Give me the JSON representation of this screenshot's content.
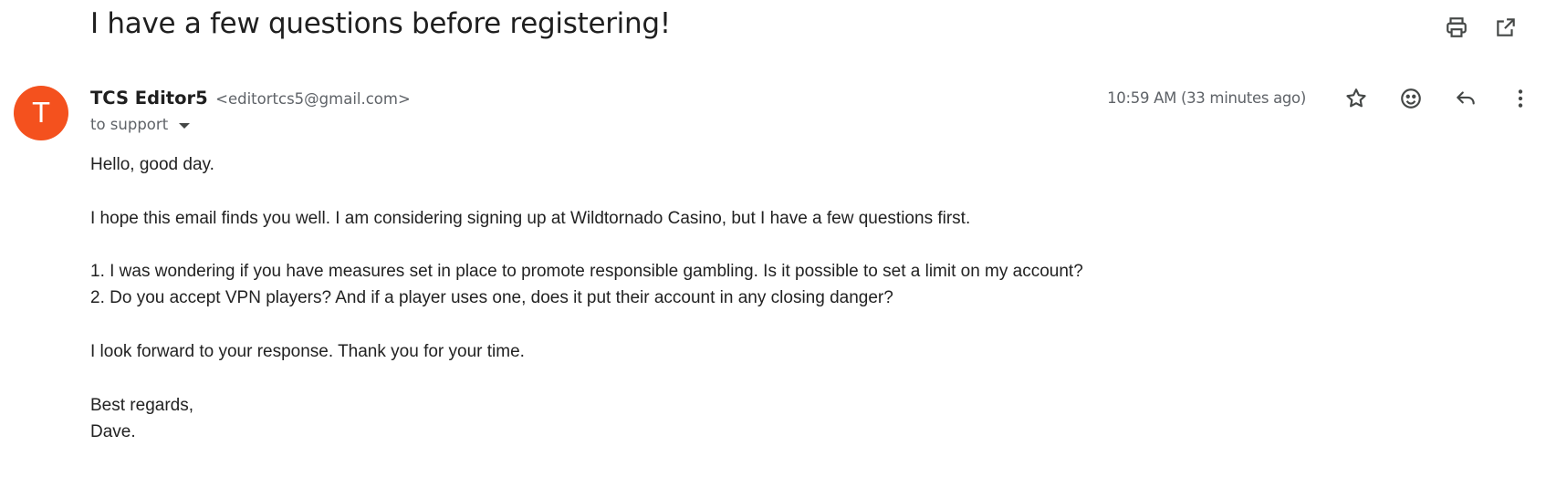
{
  "email": {
    "subject": "I have a few questions before registering!",
    "sender": {
      "avatar_initial": "T",
      "avatar_color": "#f4511e",
      "name": "TCS Editor5",
      "address": "<editortcs5@gmail.com>"
    },
    "recipient_text": "to support",
    "timestamp": "10:59 AM (33 minutes ago)",
    "body": {
      "greeting": "Hello, good day.",
      "intro": "I hope this email finds you well. I am considering signing up at Wildtornado Casino, but I have a few questions first.",
      "question_1": "1. I was wondering if you have measures set in place to promote responsible gambling. Is it possible to set a limit on my account?",
      "question_2": "2. Do you accept VPN players? And if a player uses one, does it put their account in any closing danger?",
      "closing": "I look forward to your response. Thank you for your time.",
      "signoff": "Best regards,",
      "signature": "Dave."
    }
  },
  "toolbar": {
    "top_icons": [
      "print-icon",
      "open-in-new-window-icon"
    ],
    "message_icons": [
      "star-icon",
      "emoji-reaction-icon",
      "reply-icon",
      "more-options-icon"
    ]
  }
}
